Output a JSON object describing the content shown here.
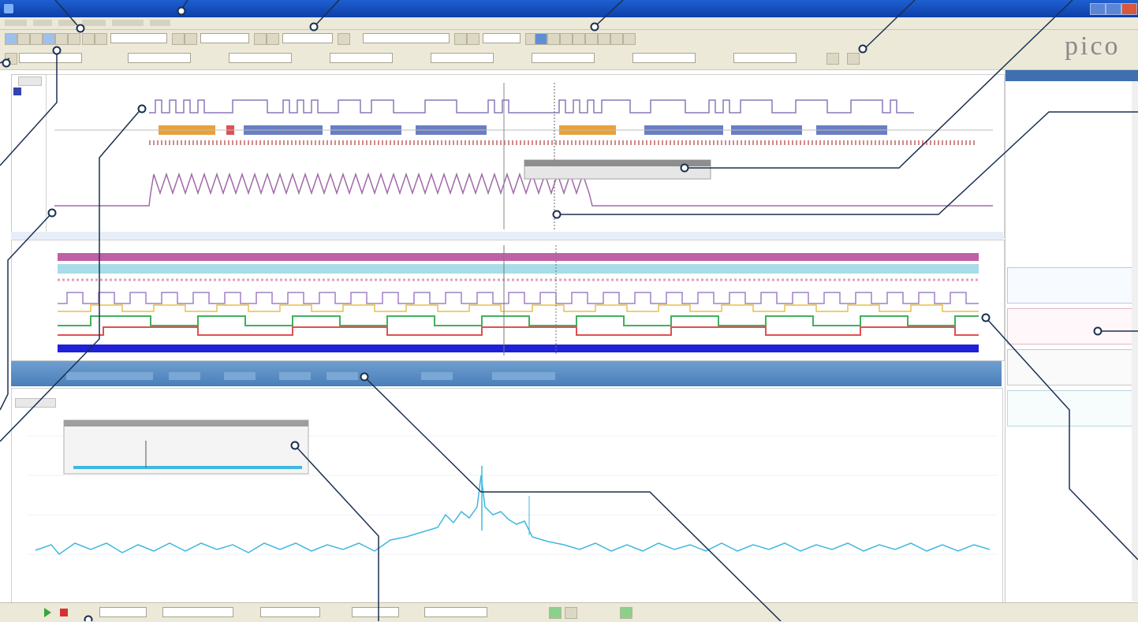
{
  "logo": {
    "text": "pico"
  },
  "colors": {
    "titlebar": "#1e5fd0",
    "chrome": "#ece9d8",
    "decode_orange": "#e8a13a",
    "decode_blue": "#6a7ec4",
    "waveform_purple": "#a06aa8",
    "trace_magenta": "#c060a8",
    "trace_cyan": "#a8dce8",
    "trace_yellow": "#e8c040",
    "trace_green": "#40b060",
    "trace_red": "#e05050",
    "trace_blue": "#2020d8",
    "spectrum": "#40b8e0",
    "callout": "#1a3050"
  },
  "icons": {
    "minimize": "minimize-icon",
    "maximize": "maximize-icon",
    "close": "close-icon",
    "play": "play-icon",
    "stop": "stop-icon"
  }
}
